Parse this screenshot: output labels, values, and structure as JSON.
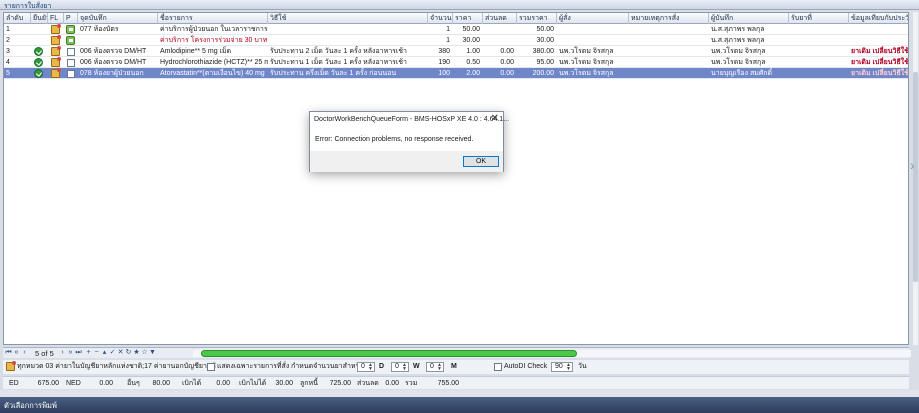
{
  "panel_title": "รายการใบสั่งยา",
  "columns": [
    "ลำดับ",
    "ยืนยัน",
    "FL",
    "P",
    "จุดบันทึก",
    "ชื่อรายการ",
    "วิธีใช้",
    "จำนวน",
    "ราคา",
    "ส่วนลด",
    "รวมราคา",
    "ผู้สั่ง",
    "หมายเหตุการสั่ง",
    "ผู้บันทึก",
    "รับยาที่",
    "ข้อมูลเทียบกับประวัติ"
  ],
  "rows": [
    {
      "no": "1",
      "confirmed": false,
      "checked": false,
      "point": "077 ห้องบัตร",
      "item": "ค่าบริการผู้ป่วยนอก ในเวลาราชการ 55",
      "usage": "",
      "qty": "1",
      "price": "50.00",
      "discount": "",
      "total": "50.00",
      "orderer": "",
      "note": "",
      "recorder": "น.ส.สุภาพร พลกุล",
      "receive": "",
      "history": ""
    },
    {
      "no": "2",
      "confirmed": false,
      "checked": false,
      "point": "",
      "item": "ค่าบริการ โครงการร่วมจ่าย 30 บาท",
      "usage": "",
      "qty": "1",
      "price": "30.00",
      "discount": "",
      "total": "30.00",
      "orderer": "",
      "note": "",
      "recorder": "น.ส.สุภาพร พลกุล",
      "receive": "",
      "history": ""
    },
    {
      "no": "3",
      "confirmed": true,
      "checked": false,
      "point": "006 ห้องตรวจ DM/HT",
      "item": "Amlodipine** 5 mg เม็ด",
      "usage": "รับประทาน 2 เม็ด วันละ 1 ครั้ง หลังอาหารเช้า",
      "qty": "380",
      "price": "1.00",
      "discount": "0.00",
      "total": "380.00",
      "orderer": "นพ.วโรดม จิรสกุล",
      "note": "",
      "recorder": "นพ.วโรดม จิรสกุล",
      "receive": "",
      "history": "ยาเดิม เปลี่ยนวิธีใช้"
    },
    {
      "no": "4",
      "confirmed": true,
      "checked": false,
      "point": "006 ห้องตรวจ DM/HT",
      "item": "Hydrochlorothiazide (HCTZ)** 25 mg",
      "usage": "รับประทาน 1 เม็ด วันละ 1 ครั้ง หลังอาหารเช้า",
      "qty": "190",
      "price": "0.50",
      "discount": "0.00",
      "total": "95.00",
      "orderer": "นพ.วโรดม จิรสกุล",
      "note": "",
      "recorder": "นพ.วโรดม จิรสกุล",
      "receive": "",
      "history": "ยาเดิม เปลี่ยนวิธีใช้"
    },
    {
      "no": "5",
      "confirmed": true,
      "checked": true,
      "point": "078 ห้องยาผู้ป่วยนอก",
      "item": "Atorvastatin**(ตามเงื่อนไข) 40 mg",
      "usage": "รับประทาน ครึ่งเม็ด วันละ 1 ครั้ง ก่อนนอน",
      "qty": "100",
      "price": "2.00",
      "discount": "0.00",
      "total": "200.00",
      "orderer": "นพ.วโรดม จิรสกุล",
      "note": "",
      "recorder": "นายบุญเรือง สมศักดิ์",
      "receive": "",
      "history": "ยาเดิม เปลี่ยนวิธีใช้"
    }
  ],
  "navigator": {
    "page": "5 of 5"
  },
  "options": {
    "rights_text": "ทุกหมวด 03 ค่ายาในบัญชียาหลักแห่งชาติ;17 ค่ายานอกบัญชียาหลั",
    "show_only_label": "แสดงเฉพาะรายการที่สั่ง",
    "qty_label": "กำหนดจำนวนยาสำหรับ",
    "d_value": "0",
    "d_label": "D",
    "w_value": "0",
    "w_label": "W",
    "m_value": "0",
    "m_label": "M",
    "autodi_label": "AutoDI Check",
    "days_value": "90",
    "days_unit": "วัน"
  },
  "totals": {
    "ed_label": "ED",
    "ed_value": "675.00",
    "ned_label": "NED",
    "ned_value": "0.00",
    "other_label": "อื่นๆ",
    "other_value": "80.00",
    "claim_label": "เบิกได้",
    "claim_value": "0.00",
    "nonclaim_label": "เบิกไม่ได้",
    "nonclaim_value": "30.00",
    "debtor_label": "ลูกหนี้",
    "debtor_value": "725.00",
    "discount_label": "ส่วนลด",
    "discount_value": "0.00",
    "sum_label": "รวม",
    "sum_value": "755.00"
  },
  "footer_title": "ตัวเลือกการพิมพ์",
  "dialog": {
    "title": "DoctorWorkBenchQueueForm - BMS-HOSxP XE 4.0 : 4.64.1...",
    "message": "Error: Connection problems, no response received.",
    "ok_label": "OK",
    "close_glyph": "✕"
  },
  "icons": {
    "confirm": "check-circle-icon",
    "edit": "edit-pencil-icon",
    "note": "note-bubble-icon"
  },
  "colors": {
    "selected_row": "#6f86c9",
    "history_red": "#b00020",
    "progress_green": "#4ac84a",
    "footer_bar": "#2c3d5c"
  }
}
